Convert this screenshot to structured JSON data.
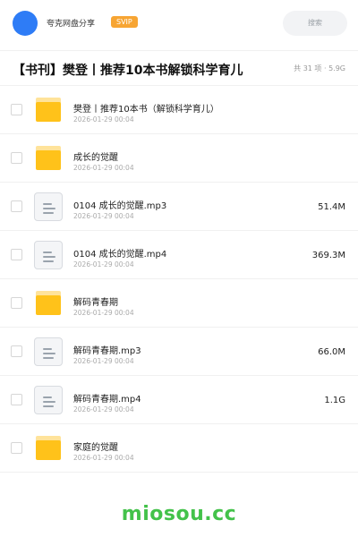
{
  "header": {
    "user_name": "夸克网盘分享",
    "badge": "SVIP",
    "search_label": "搜索",
    "avatar_color": "#2e7cf6"
  },
  "folder": {
    "title": "【书刊】樊登丨推荐10本书解锁科学育儿",
    "meta": "共 31 项 · 5.9G"
  },
  "files": [
    {
      "name": "樊登丨推荐10本书（解锁科学育儿）",
      "date": "2026-01-29 00:04",
      "size": "",
      "icon": "folder-icon"
    },
    {
      "name": "成长的觉醒",
      "date": "2026-01-29 00:04",
      "size": "",
      "icon": "folder-icon"
    },
    {
      "name": "0104 成长的觉醒.mp3",
      "date": "2026-01-29 00:04",
      "size": "51.4M",
      "icon": "file-icon"
    },
    {
      "name": "0104 成长的觉醒.mp4",
      "date": "2026-01-29 00:04",
      "size": "369.3M",
      "icon": "file-icon"
    },
    {
      "name": "解码青春期",
      "date": "2026-01-29 00:04",
      "size": "",
      "icon": "folder-icon"
    },
    {
      "name": "解码青春期.mp3",
      "date": "2026-01-29 00:04",
      "size": "66.0M",
      "icon": "file-icon"
    },
    {
      "name": "解码青春期.mp4",
      "date": "2026-01-29 00:04",
      "size": "1.1G",
      "icon": "file-icon"
    },
    {
      "name": "家庭的觉醒",
      "date": "2026-01-29 00:04",
      "size": "",
      "icon": "folder-icon"
    }
  ],
  "footer": {
    "watermark": "miosou.cc",
    "watermark_color": "#43c24a"
  }
}
